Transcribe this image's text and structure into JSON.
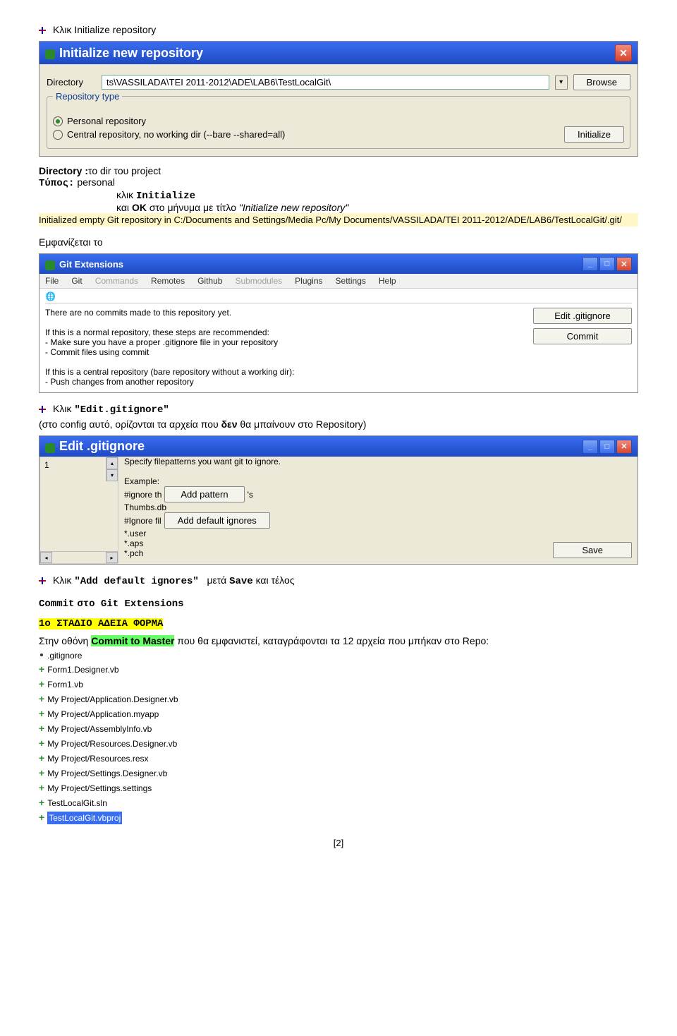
{
  "title_line": "Κλικ Initialize repository",
  "dialog1": {
    "title": "Initialize new repository",
    "dir_label": "Directory",
    "dir_value": "ts\\VASSILADA\\TEI 2011-2012\\ADE\\LAB6\\TestLocalGit\\",
    "browse": "Browse",
    "group": "Repository type",
    "opt1": "Personal repository",
    "opt2": "Central repository, no working dir   (--bare --shared=all)",
    "init": "Initialize"
  },
  "info1": {
    "l0a": "Directory :",
    "l0b": "το dir του project",
    "l1a": "Τύπος:",
    "l1b": "personal",
    "l2a": "κλικ",
    "l2b": "Initialize",
    "l3a": "και",
    "l3b": "ΟΚ",
    "l3c": "στο μήνυμα με τίτλο",
    "l3d": "\"Initialize new repository\""
  },
  "init_msg": "Initialized empty Git repository in C:/Documents and Settings/Media Pc/My Documents/VASSILADA/TEI 2011-2012/ADE/LAB6/TestLocalGit/.git/",
  "appears": "Εμφανίζεται το",
  "gitext": {
    "title": "Git Extensions",
    "menu": [
      "File",
      "Git",
      "Commands",
      "Remotes",
      "Github",
      "Submodules",
      "Plugins",
      "Settings",
      "Help"
    ],
    "text1": "There are no commits made to this repository yet.",
    "text2": "If this is a normal repository, these steps are recommended:",
    "text3": "- Make sure you have a proper .gitignore file in your repository",
    "text4": "- Commit files using commit",
    "text5": "If this is a central repository (bare repository without a working dir):",
    "text6": "- Push changes from another repository",
    "btn_gitignore": "Edit .gitignore",
    "btn_commit": "Commit"
  },
  "edit_line": {
    "a": "Κλικ",
    "b": "\"Edit.gitignore\""
  },
  "edit_note": {
    "a": "(στο config αυτό, ορίζονται τα αρχεία που ",
    "b": "δεν",
    "c": " θα μπαίνουν στο Repository)"
  },
  "gitignore_dlg": {
    "title": "Edit .gitignore",
    "desc": "Specify filepatterns you want git to ignore.",
    "example": "Example:",
    "ex1": "#ignore th",
    "ex1b": "'s",
    "ex2": "Thumbs.db",
    "ex3": "#Ignore fil",
    "ex4": "*.user",
    "ex5": "*.aps",
    "ex6": "*.pch",
    "btn_add": "Add pattern",
    "btn_def": "Add default ignores",
    "save": "Save"
  },
  "add_def_line": {
    "a": "Κλικ",
    "b": "\"Add default ignores\"",
    "c": "μετά",
    "d": "Save",
    "e": "και τέλος"
  },
  "commit_head": {
    "a": "Commit",
    "b": "στο Git Extensions"
  },
  "stage1": "1ο ΣΤΑΔΙΟ ΑΔΕΙΑ ΦΟΡΜΑ",
  "commit_line": {
    "a": "Στην οθόνη",
    "b": "Commit to Master",
    "c": "που θα εμφανιστεί, καταγράφονται τα 12 αρχεία που μπήκαν στο Repo:"
  },
  "files": [
    ".gitignore",
    "Form1.Designer.vb",
    "Form1.vb",
    "My Project/Application.Designer.vb",
    "My Project/Application.myapp",
    "My Project/AssemblyInfo.vb",
    "My Project/Resources.Designer.vb",
    "My Project/Resources.resx",
    "My Project/Settings.Designer.vb",
    "My Project/Settings.settings",
    "TestLocalGit.sln",
    "TestLocalGit.vbproj"
  ],
  "page_num": "[2]"
}
